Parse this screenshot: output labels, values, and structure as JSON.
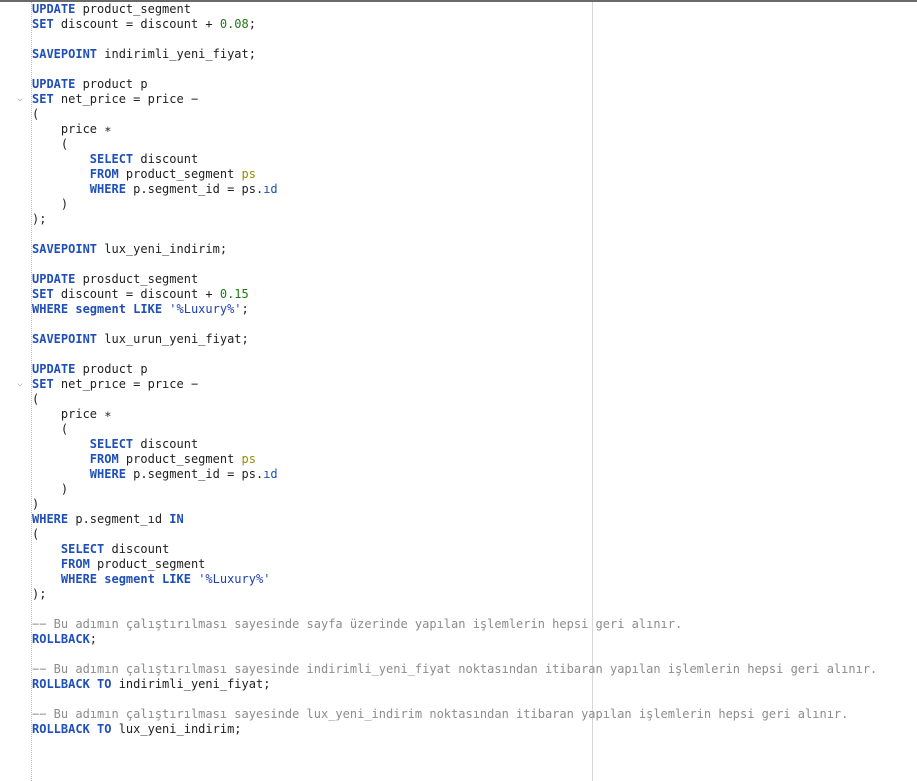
{
  "editor": {
    "indent_unit": "    ",
    "folds": [
      6,
      25
    ],
    "current_line": 49,
    "lines": [
      [
        [
          "k",
          "UPDATE"
        ],
        [
          "p",
          " product_segment"
        ]
      ],
      [
        [
          "k",
          "SET"
        ],
        [
          "p",
          " discount = discount + "
        ],
        [
          "n",
          "0.08"
        ],
        [
          "p",
          ";"
        ]
      ],
      [],
      [
        [
          "k",
          "SAVEPOINT"
        ],
        [
          "p",
          " indirimli_yeni_fiyat;"
        ]
      ],
      [],
      [
        [
          "k",
          "UPDATE"
        ],
        [
          "p",
          " product p"
        ]
      ],
      [
        [
          "k",
          "SET"
        ],
        [
          "p",
          " net_price = price −"
        ]
      ],
      [
        [
          "p",
          "("
        ]
      ],
      [
        [
          "p",
          "    price ∗"
        ]
      ],
      [
        [
          "p",
          "    ("
        ]
      ],
      [
        [
          "p",
          "        "
        ],
        [
          "k",
          "SELECT"
        ],
        [
          "p",
          " discount"
        ]
      ],
      [
        [
          "p",
          "        "
        ],
        [
          "k",
          "FROM"
        ],
        [
          "p",
          " product_segment "
        ],
        [
          "a",
          "ps"
        ]
      ],
      [
        [
          "p",
          "        "
        ],
        [
          "k",
          "WHERE"
        ],
        [
          "p",
          " p.segment_id = ps."
        ],
        [
          "f",
          "ıd"
        ]
      ],
      [
        [
          "p",
          "    )"
        ]
      ],
      [
        [
          "p",
          ");"
        ]
      ],
      [],
      [
        [
          "k",
          "SAVEPOINT"
        ],
        [
          "p",
          " lux_yeni_indirim;"
        ]
      ],
      [],
      [
        [
          "k",
          "UPDATE"
        ],
        [
          "p",
          " prosduct_segment"
        ]
      ],
      [
        [
          "k",
          "SET"
        ],
        [
          "p",
          " discount = discount + "
        ],
        [
          "n",
          "0.15"
        ]
      ],
      [
        [
          "k",
          "WHERE segment LIKE "
        ],
        [
          "s",
          "'%Luxury%'"
        ],
        [
          "p",
          ";"
        ]
      ],
      [],
      [
        [
          "k",
          "SAVEPOINT"
        ],
        [
          "p",
          " lux_urun_yeni_fiyat;"
        ]
      ],
      [],
      [
        [
          "k",
          "UPDATE"
        ],
        [
          "p",
          " product p"
        ]
      ],
      [
        [
          "k",
          "SET"
        ],
        [
          "p",
          " net_prıce = prıce −"
        ]
      ],
      [
        [
          "p",
          "("
        ]
      ],
      [
        [
          "p",
          "    price ∗"
        ]
      ],
      [
        [
          "p",
          "    ("
        ]
      ],
      [
        [
          "p",
          "        "
        ],
        [
          "k",
          "SELECT"
        ],
        [
          "p",
          " discount"
        ]
      ],
      [
        [
          "p",
          "        "
        ],
        [
          "k",
          "FROM"
        ],
        [
          "p",
          " product_segment "
        ],
        [
          "a",
          "ps"
        ]
      ],
      [
        [
          "p",
          "        "
        ],
        [
          "k",
          "WHERE"
        ],
        [
          "p",
          " p.segment_id = ps."
        ],
        [
          "f",
          "ıd"
        ]
      ],
      [
        [
          "p",
          "    )"
        ]
      ],
      [
        [
          "p",
          ")"
        ]
      ],
      [
        [
          "k",
          "WHERE"
        ],
        [
          "p",
          " p.segment_ıd "
        ],
        [
          "k",
          "IN"
        ]
      ],
      [
        [
          "p",
          "("
        ]
      ],
      [
        [
          "p",
          "    "
        ],
        [
          "k",
          "SELECT"
        ],
        [
          "p",
          " discount"
        ]
      ],
      [
        [
          "p",
          "    "
        ],
        [
          "k",
          "FROM"
        ],
        [
          "p",
          " product_segment"
        ]
      ],
      [
        [
          "p",
          "    "
        ],
        [
          "k",
          "WHERE segment LIKE "
        ],
        [
          "s",
          "'%Luxury%'"
        ]
      ],
      [
        [
          "p",
          ");"
        ]
      ],
      [],
      [
        [
          "c",
          "−− Bu adımın çalıştırılması sayesinde sayfa üzerinde yapılan işlemlerin hepsi geri alınır."
        ]
      ],
      [
        [
          "k",
          "ROLLBACK"
        ],
        [
          "p",
          ";"
        ]
      ],
      [],
      [
        [
          "c",
          "−− Bu adımın çalıştırılması sayesinde indirimli_yeni_fiyat noktasından itibaran yapılan işlemlerin hepsi geri alınır."
        ]
      ],
      [
        [
          "k",
          "ROLLBACK TO"
        ],
        [
          "p",
          " indirimli_yeni_fiyat;"
        ]
      ],
      [],
      [
        [
          "c",
          "−− Bu adımın çalıştırılması sayesinde lux_yeni_indirim noktasından itibaran yapılan işlemlerin hepsi geri alınır."
        ]
      ],
      [
        [
          "k",
          "ROLLBACK TO"
        ],
        [
          "p",
          " lux_yeni_indirim;"
        ]
      ]
    ]
  }
}
